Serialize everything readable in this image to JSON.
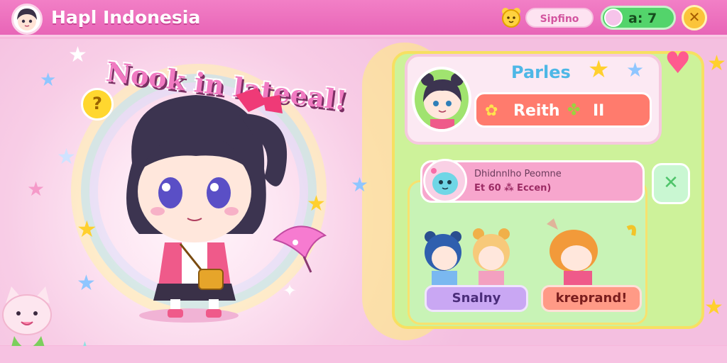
{
  "header": {
    "title": "Hapl Indonesia",
    "currency_label": "Sipfino",
    "gem_count": "a: 7",
    "close_symbol": "✕"
  },
  "hero": {
    "headline": "Nook in lateeal!",
    "help_symbol": "?"
  },
  "profile": {
    "name": "Parles",
    "status_label": "Reith",
    "status_level": "II"
  },
  "friend_request": {
    "title": "Dhidnnlho Peomne",
    "subtitle": "Et 60 ⁂ Eccen)",
    "close_symbol": "✕"
  },
  "buttons": {
    "left_label": "Snalny",
    "right_label": "kreprand!"
  },
  "colors": {
    "topbar": "#e865b7",
    "panel": "#cdf29a",
    "status_bar": "#ff7b6d",
    "left_button": "#c9a7f3",
    "right_button": "#ff9a86"
  }
}
